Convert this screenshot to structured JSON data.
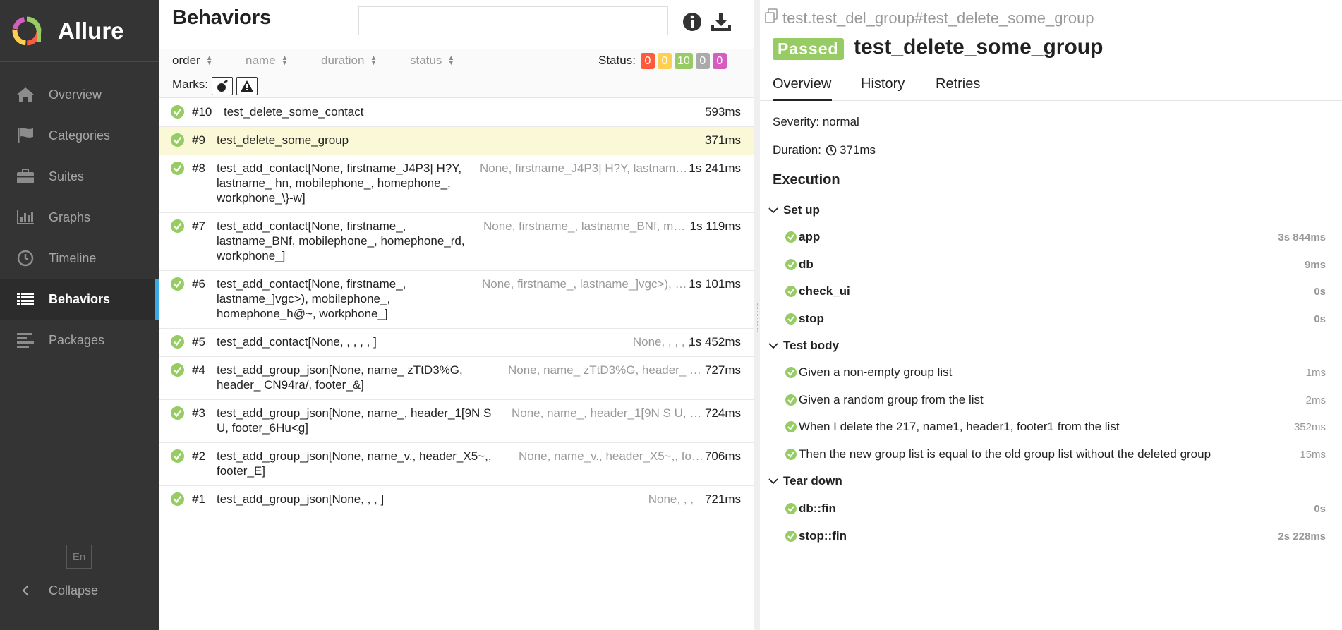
{
  "app": {
    "name": "Allure"
  },
  "sidebar": {
    "items": [
      {
        "label": "Overview",
        "icon": "home-icon",
        "active": false
      },
      {
        "label": "Categories",
        "icon": "flag-icon",
        "active": false
      },
      {
        "label": "Suites",
        "icon": "briefcase-icon",
        "active": false
      },
      {
        "label": "Graphs",
        "icon": "bar-chart-icon",
        "active": false
      },
      {
        "label": "Timeline",
        "icon": "clock-icon",
        "active": false
      },
      {
        "label": "Behaviors",
        "icon": "list-icon",
        "active": true
      },
      {
        "label": "Packages",
        "icon": "align-left-icon",
        "active": false
      }
    ],
    "language": "En",
    "collapse_label": "Collapse"
  },
  "middle": {
    "title": "Behaviors",
    "search": {
      "value": "",
      "placeholder": ""
    },
    "sort": {
      "order": "order",
      "name": "name",
      "duration": "duration",
      "status": "status"
    },
    "status_label": "Status:",
    "status_counts": [
      {
        "value": "0",
        "color": "#fd5a3e",
        "name": "failed"
      },
      {
        "value": "0",
        "color": "#ffd050",
        "name": "broken"
      },
      {
        "value": "10",
        "color": "#97cc64",
        "name": "passed"
      },
      {
        "value": "0",
        "color": "#aaaaaa",
        "name": "skipped"
      },
      {
        "value": "0",
        "color": "#d35ebe",
        "name": "unknown"
      }
    ],
    "marks_label": "Marks:",
    "tests": [
      {
        "num": "#10",
        "name": "test_delete_some_contact",
        "params": "",
        "duration": "593ms",
        "selected": false
      },
      {
        "num": "#9",
        "name": "test_delete_some_group",
        "params": "",
        "duration": "371ms",
        "selected": true
      },
      {
        "num": "#8",
        "name": "test_add_contact[None, firstname_J4P3| H?Y, lastname_ hn, mobilephone_, homephone_, workphone_\\}-w]",
        "params": "None, firstname_J4P3| H?Y, lastname_ hn, mobilephone_, homephone_, workphone_\\}-w",
        "duration": "1s 241ms",
        "selected": false
      },
      {
        "num": "#7",
        "name": "test_add_contact[None, firstname_, lastname_BNf, mobilephone_, homephone_rd, workphone_]",
        "params": "None, firstname_, lastname_BNf, mobilephone_, homephone_rd, workphone_",
        "duration": "1s 119ms",
        "selected": false
      },
      {
        "num": "#6",
        "name": "test_add_contact[None, firstname_, lastname_]vgc>), mobilephone_, homephone_h@~, workphone_]",
        "params": "None, firstname_, lastname_]vgc>), mobilephone_, homephone_h@~, workphone_",
        "duration": "1s 101ms",
        "selected": false
      },
      {
        "num": "#5",
        "name": "test_add_contact[None, , , , , ]",
        "params": "None, , , , ,",
        "duration": "1s 452ms",
        "selected": false
      },
      {
        "num": "#4",
        "name": "test_add_group_json[None, name_ zTtD3%G, header_ CN94ra/, footer_&]",
        "params": "None, name_ zTtD3%G, header_ CN94ra/, footer_&",
        "duration": "727ms",
        "selected": false
      },
      {
        "num": "#3",
        "name": "test_add_group_json[None, name_, header_1[9N S U, footer_6Hu<g]",
        "params": "None, name_, header_1[9N S U, footer_6Hu<g",
        "duration": "724ms",
        "selected": false
      },
      {
        "num": "#2",
        "name": "test_add_group_json[None, name_v., header_X5~,, footer_E]",
        "params": "None, name_v., header_X5~,, footer_E",
        "duration": "706ms",
        "selected": false
      },
      {
        "num": "#1",
        "name": "test_add_group_json[None, , , ]",
        "params": "None, , ,",
        "duration": "721ms",
        "selected": false
      }
    ]
  },
  "detail": {
    "path": "test.test_del_group#test_delete_some_group",
    "status": "Passed",
    "title": "test_delete_some_group",
    "tabs": [
      "Overview",
      "History",
      "Retries"
    ],
    "severity": "Severity: normal",
    "duration_label": "Duration:",
    "duration_value": "371ms",
    "execution_title": "Execution",
    "setup": {
      "label": "Set up",
      "steps": [
        {
          "name": "app",
          "duration": "3s 844ms"
        },
        {
          "name": "db",
          "duration": "9ms"
        },
        {
          "name": "check_ui",
          "duration": "0s"
        },
        {
          "name": "stop",
          "duration": "0s"
        }
      ]
    },
    "body": {
      "label": "Test body",
      "steps": [
        {
          "name": "Given a non-empty group list",
          "duration": "1ms"
        },
        {
          "name": "Given a random group from the list",
          "duration": "2ms"
        },
        {
          "name": "When I delete the 217, name1, header1, footer1 from the list",
          "duration": "352ms"
        },
        {
          "name": "Then the new group list is equal to the old group list without the deleted group",
          "duration": "15ms"
        }
      ]
    },
    "teardown": {
      "label": "Tear down",
      "steps": [
        {
          "name": "db::fin",
          "duration": "0s"
        },
        {
          "name": "stop::fin",
          "duration": "2s 228ms"
        }
      ]
    }
  }
}
